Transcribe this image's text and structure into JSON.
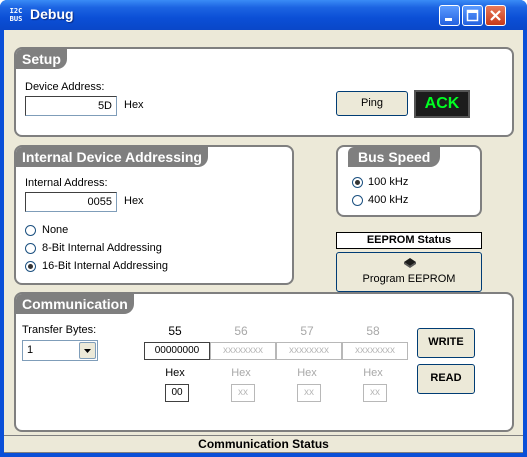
{
  "window": {
    "title": "Debug",
    "icon_text": "I2C BUS",
    "icon": "app-icon",
    "buttons": [
      "minimize-icon",
      "maximize-icon",
      "close-icon"
    ]
  },
  "setup": {
    "heading": "Setup",
    "device_address_label": "Device Address:",
    "device_address_value": "5D",
    "hex_label": "Hex",
    "ping_label": "Ping",
    "ack_label": "ACK"
  },
  "internal": {
    "heading": "Internal Device Addressing",
    "internal_address_label": "Internal Address:",
    "internal_address_value": "0055",
    "hex_label": "Hex",
    "options": [
      "None",
      "8-Bit Internal Addressing",
      "16-Bit Internal Addressing"
    ],
    "selected": "16-Bit Internal Addressing"
  },
  "bus_speed": {
    "heading": "Bus Speed",
    "options": [
      "100 kHz",
      "400 kHz"
    ],
    "selected": "100 kHz"
  },
  "eeprom": {
    "status_label": "EEPROM Status",
    "program_label": "Program EEPROM",
    "icon": "chip-icon"
  },
  "communication": {
    "heading": "Communication",
    "transfer_bytes_label": "Transfer Bytes:",
    "transfer_bytes_value": "1",
    "columns": [
      {
        "address": "55",
        "binary": "00000000",
        "hex_label": "Hex",
        "hex": "00",
        "enabled": true
      },
      {
        "address": "56",
        "binary": "xxxxxxxx",
        "hex_label": "Hex",
        "hex": "xx",
        "enabled": false
      },
      {
        "address": "57",
        "binary": "xxxxxxxx",
        "hex_label": "Hex",
        "hex": "xx",
        "enabled": false
      },
      {
        "address": "58",
        "binary": "xxxxxxxx",
        "hex_label": "Hex",
        "hex": "xx",
        "enabled": false
      }
    ],
    "write_label": "WRITE",
    "read_label": "READ"
  },
  "status_bar": {
    "text": "Communication Status"
  },
  "colors": {
    "title_blue": "#0b4fd6",
    "group_grey": "#7f7f7f",
    "ack_green": "#00ff22",
    "face": "#ece9d8"
  }
}
